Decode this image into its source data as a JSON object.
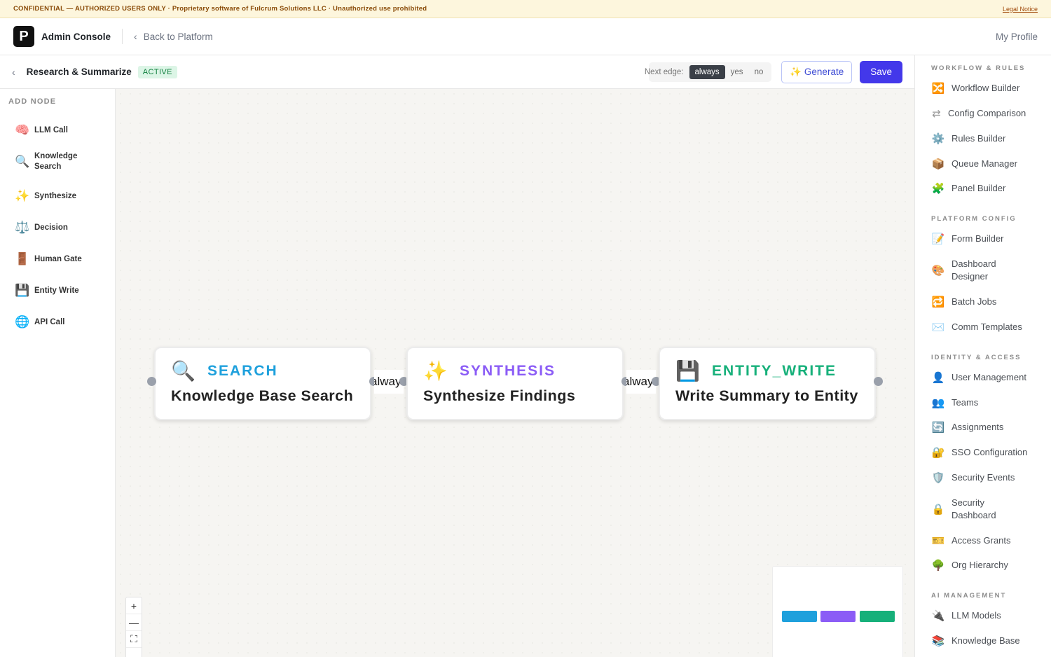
{
  "banner": {
    "text": "CONFIDENTIAL — AUTHORIZED USERS ONLY · Proprietary software of Fulcrum Solutions LLC · Unauthorized use prohibited",
    "legal_link": "Legal Notice"
  },
  "header": {
    "logo_letter": "P",
    "app_name": "Admin Console",
    "back_label": "Back to Platform",
    "profile_label": "My Profile"
  },
  "editor": {
    "workflow_name": "Research & Summarize",
    "status": "ACTIVE",
    "next_edge_label": "Next edge:",
    "edge_options": [
      "always",
      "yes",
      "no"
    ],
    "generate_label": "✨ Generate",
    "save_label": "Save"
  },
  "palette": {
    "title": "ADD NODE",
    "items": [
      {
        "icon": "🧠",
        "label": "LLM Call"
      },
      {
        "icon": "🔍",
        "label": "Knowledge Search"
      },
      {
        "icon": "✨",
        "label": "Synthesize"
      },
      {
        "icon": "⚖️",
        "label": "Decision"
      },
      {
        "icon": "🚪",
        "label": "Human Gate"
      },
      {
        "icon": "💾",
        "label": "Entity Write"
      },
      {
        "icon": "🌐",
        "label": "API Call"
      }
    ]
  },
  "canvas": {
    "nodes": [
      {
        "icon": "🔍",
        "type": "SEARCH",
        "title": "Knowledge Base Search",
        "color": "#1ea0dc"
      },
      {
        "icon": "✨",
        "type": "SYNTHESIS",
        "title": "Synthesize Findings",
        "color": "#8b5cf6"
      },
      {
        "icon": "💾",
        "type": "ENTITY_WRITE",
        "title": "Write Summary to Entity",
        "color": "#16b07a"
      }
    ],
    "edges": [
      "always",
      "always"
    ],
    "zoom_controls": [
      "+",
      "—",
      "⛶",
      "→"
    ]
  },
  "rightnav": {
    "sections": [
      {
        "title": "WORKFLOW & RULES",
        "items": [
          {
            "icon": "🔀",
            "label": "Workflow Builder"
          },
          {
            "icon": "⇄",
            "label": "Config Comparison"
          },
          {
            "icon": "⚙️",
            "label": "Rules Builder"
          },
          {
            "icon": "📦",
            "label": "Queue Manager"
          },
          {
            "icon": "🧩",
            "label": "Panel Builder"
          }
        ]
      },
      {
        "title": "PLATFORM CONFIG",
        "items": [
          {
            "icon": "📝",
            "label": "Form Builder"
          },
          {
            "icon": "🎨",
            "label": "Dashboard Designer"
          },
          {
            "icon": "🔁",
            "label": "Batch Jobs"
          },
          {
            "icon": "✉️",
            "label": "Comm Templates"
          }
        ]
      },
      {
        "title": "IDENTITY & ACCESS",
        "items": [
          {
            "icon": "👤",
            "label": "User Management"
          },
          {
            "icon": "👥",
            "label": "Teams"
          },
          {
            "icon": "🔄",
            "label": "Assignments"
          },
          {
            "icon": "🔐",
            "label": "SSO Configuration"
          },
          {
            "icon": "🛡️",
            "label": "Security Events"
          },
          {
            "icon": "🔒",
            "label": "Security Dashboard"
          },
          {
            "icon": "🎫",
            "label": "Access Grants"
          },
          {
            "icon": "🌳",
            "label": "Org Hierarchy"
          }
        ]
      },
      {
        "title": "AI MANAGEMENT",
        "items": [
          {
            "icon": "🔌",
            "label": "LLM Models"
          },
          {
            "icon": "📚",
            "label": "Knowledge Base"
          }
        ]
      }
    ]
  }
}
